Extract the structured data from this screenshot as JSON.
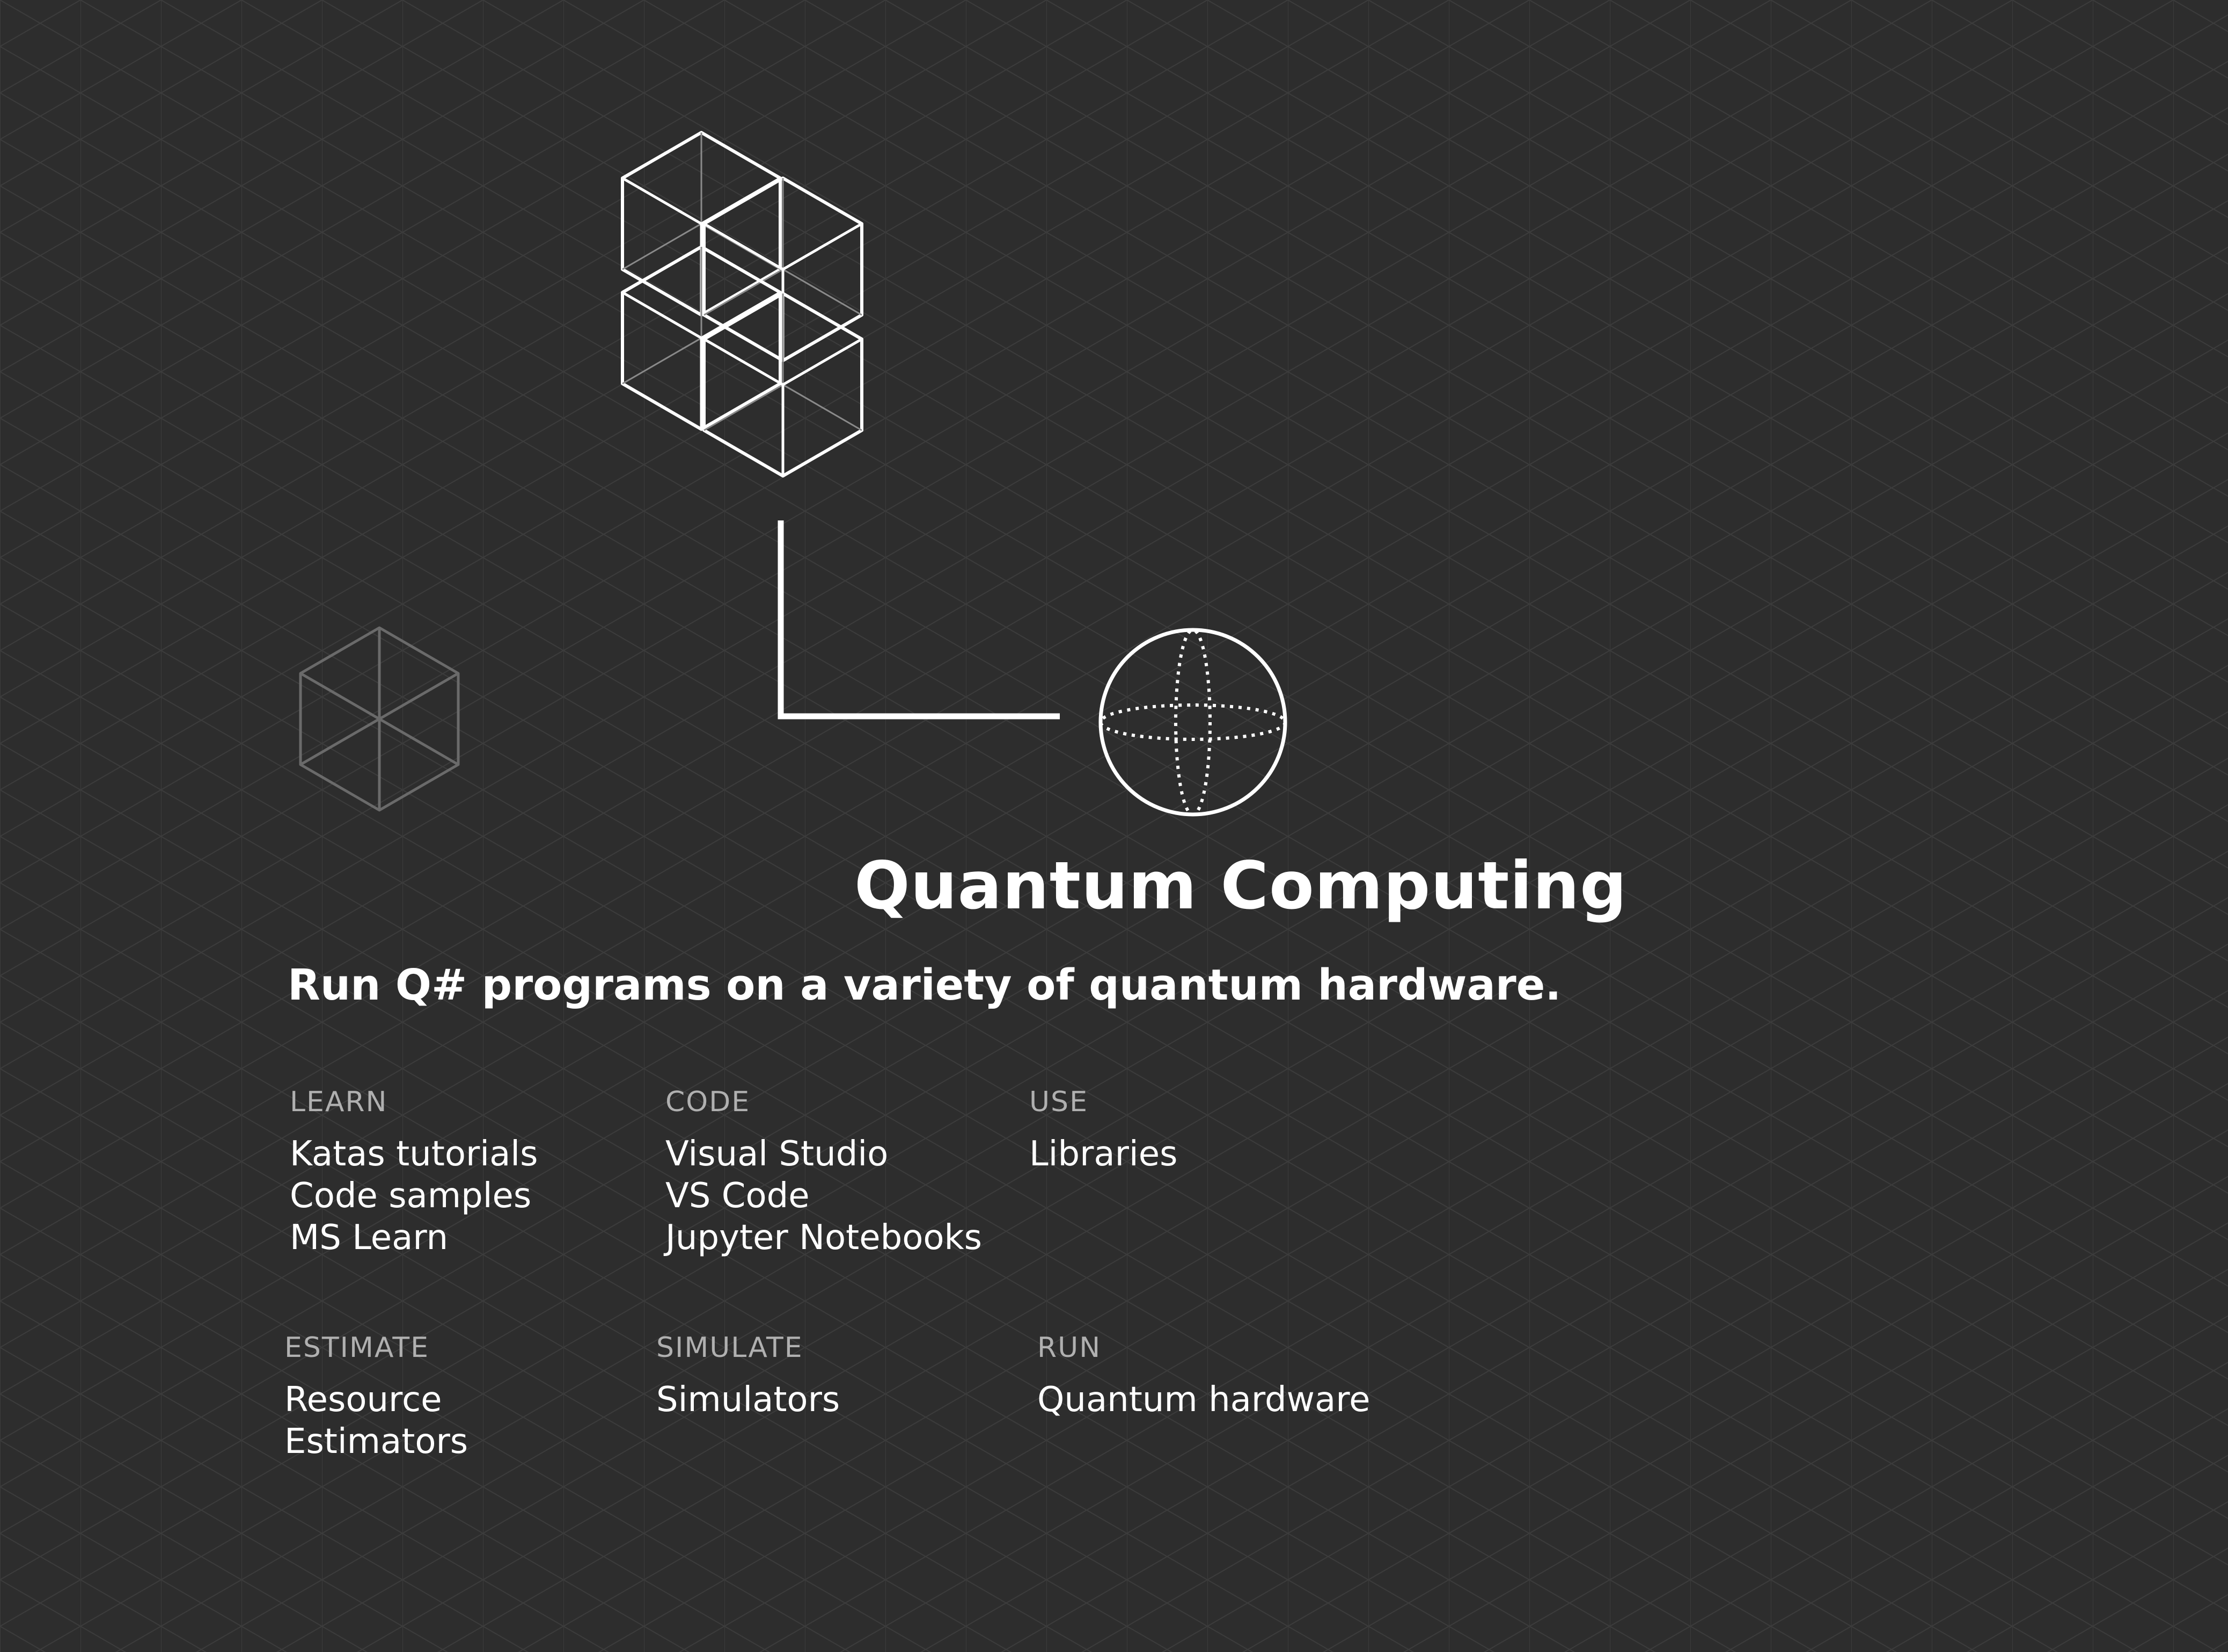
{
  "title": "Quantum Computing",
  "subtitle": "Run Q# programs on a variety of quantum hardware.",
  "sections": [
    {
      "heading": "LEARN",
      "items": [
        "Katas tutorials",
        "Code samples",
        "MS Learn"
      ]
    },
    {
      "heading": "CODE",
      "items": [
        "Visual Studio",
        "VS Code",
        "Jupyter Notebooks"
      ]
    },
    {
      "heading": "USE",
      "items": [
        "Libraries"
      ]
    },
    {
      "heading": "ESTIMATE",
      "items": [
        "Resource",
        "Estimators"
      ]
    },
    {
      "heading": "SIMULATE",
      "items": [
        "Simulators"
      ]
    },
    {
      "heading": "RUN",
      "items": [
        "Quantum hardware"
      ]
    }
  ],
  "colors": {
    "background": "#2d2d2d",
    "grid": "#3c3c3c",
    "foreground": "#ffffff",
    "muted": "#b0b0b0",
    "faded_icon": "#6a6a6a"
  },
  "icons": [
    "hexagon-cluster-icon",
    "hexagon-icon",
    "sphere-qubit-icon"
  ]
}
